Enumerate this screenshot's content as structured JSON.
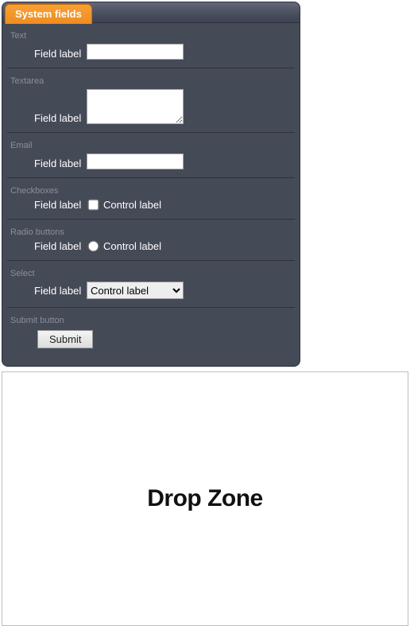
{
  "tab_label": "System fields",
  "sections": {
    "text": {
      "title": "Text",
      "field_label": "Field label"
    },
    "textarea": {
      "title": "Textarea",
      "field_label": "Field label"
    },
    "email": {
      "title": "Email",
      "field_label": "Field label"
    },
    "checkboxes": {
      "title": "Checkboxes",
      "field_label": "Field label",
      "control_label": "Control label"
    },
    "radio": {
      "title": "Radio buttons",
      "field_label": "Field label",
      "control_label": "Control label"
    },
    "select": {
      "title": "Select",
      "field_label": "Field label",
      "control_label": "Control label"
    },
    "submit": {
      "title": "Submit button",
      "button_label": "Submit"
    }
  },
  "dropzone_label": "Drop Zone"
}
